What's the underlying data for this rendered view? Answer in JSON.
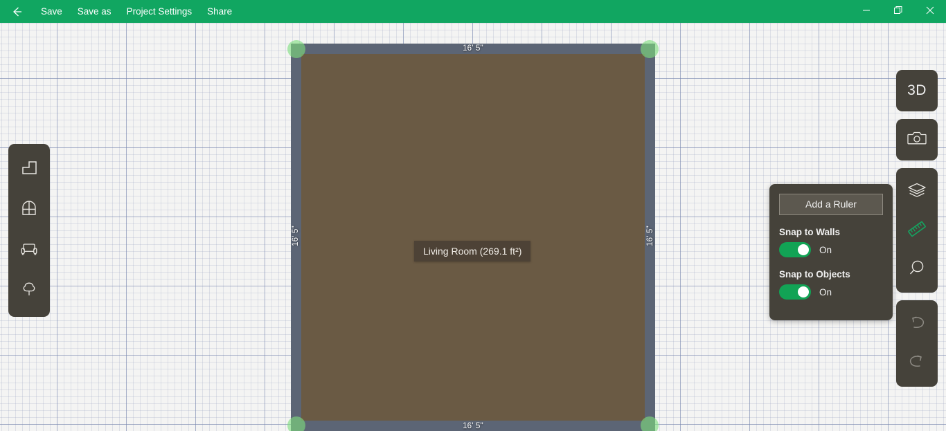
{
  "titlebar": {
    "back_icon": "back-arrow-icon",
    "menu": [
      {
        "label": "Save",
        "name": "menu-save"
      },
      {
        "label": "Save as",
        "name": "menu-save-as"
      },
      {
        "label": "Project Settings",
        "name": "menu-project-settings"
      },
      {
        "label": "Share",
        "name": "menu-share"
      }
    ],
    "window_controls": [
      {
        "name": "minimize-button",
        "icon": "minimize-icon"
      },
      {
        "name": "maximize-button",
        "icon": "restore-icon"
      },
      {
        "name": "close-button",
        "icon": "close-icon"
      }
    ],
    "background_color": "#11a661"
  },
  "left_rail": {
    "tools": [
      {
        "name": "tool-rooms",
        "icon": "l-shaped-room-icon"
      },
      {
        "name": "tool-windows",
        "icon": "arched-window-icon"
      },
      {
        "name": "tool-furniture",
        "icon": "armchair-icon"
      },
      {
        "name": "tool-outdoor",
        "icon": "tree-icon"
      }
    ]
  },
  "right_rail": {
    "view_3d_label": "3D",
    "buttons": [
      {
        "name": "view-3d-button",
        "icon": "3d-icon"
      },
      {
        "name": "screenshot-button",
        "icon": "camera-icon"
      },
      {
        "name": "layers-button",
        "icon": "layers-icon"
      },
      {
        "name": "ruler-button",
        "icon": "ruler-icon",
        "active": true
      },
      {
        "name": "zoom-button",
        "icon": "magnifier-icon"
      },
      {
        "name": "undo-button",
        "icon": "undo-arrow-icon",
        "disabled": true
      },
      {
        "name": "redo-button",
        "icon": "redo-arrow-icon",
        "disabled": true
      }
    ],
    "accent_color": "#17a05f"
  },
  "settings_panel": {
    "add_ruler_label": "Add a Ruler",
    "snap_to_walls": {
      "title": "Snap to Walls",
      "state": "On"
    },
    "snap_to_objects": {
      "title": "Snap to Objects",
      "state": "On"
    },
    "toggle_on_color": "#12a355"
  },
  "floorplan": {
    "room_label": "Living Room (269.1 ft²)",
    "dimensions": {
      "top": "16' 5\"",
      "bottom": "16' 5\"",
      "left": "16' 5\"",
      "right": "16' 5\""
    },
    "wall_color": "#5c6575",
    "floor_color": "#6a5a44",
    "handle_color": "#7edd7e",
    "handles": [
      {
        "name": "corner-handle-top-left"
      },
      {
        "name": "corner-handle-top-right"
      },
      {
        "name": "corner-handle-bottom-left"
      },
      {
        "name": "corner-handle-bottom-right"
      }
    ]
  }
}
